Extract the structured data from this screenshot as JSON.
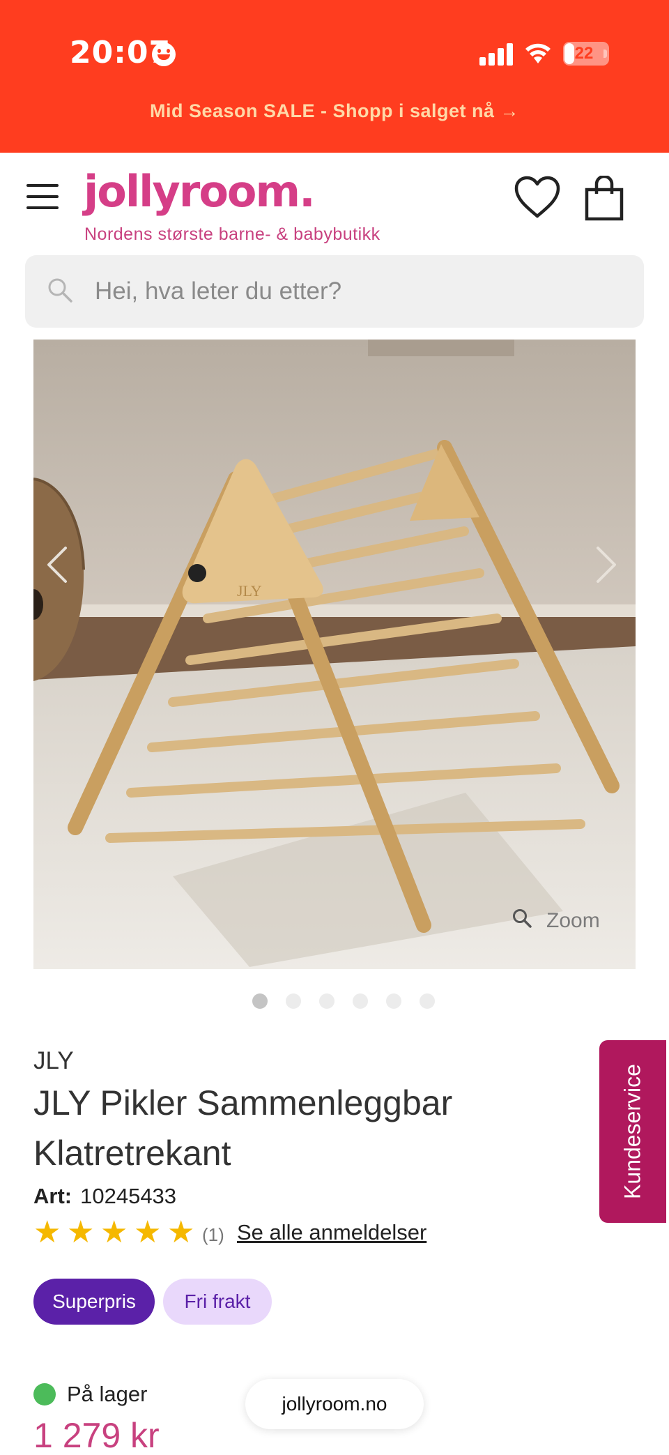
{
  "status_bar": {
    "time": "20:07",
    "battery": "22",
    "battery_level": 0.22,
    "background": "#ff3d1f"
  },
  "promo": {
    "text": "Mid Season SALE - Shopp i salget nå →"
  },
  "header": {
    "logo": "jollyroom.",
    "tagline": "Nordens største barne- & babybutikk",
    "brand_color": "#d53e87",
    "icons": [
      "menu-icon",
      "heart-icon",
      "bag-icon"
    ]
  },
  "search": {
    "placeholder": "Hei, hva leter du etter?"
  },
  "gallery": {
    "zoom_label": "Zoom",
    "image_count": 6,
    "active_index": 0
  },
  "product": {
    "brand": "JLY",
    "title": "JLY Pikler Sammenleggbar Klatretrekant",
    "art_label": "Art:",
    "art_number": "10245433",
    "rating": 5,
    "review_count": "(1)",
    "reviews_link": "Se alle anmeldelser",
    "badges": {
      "superpris": "Superpris",
      "fri_frakt": "Fri frakt"
    },
    "stock": "På lager",
    "stock_color": "#4cbb5a",
    "price": "1 279 kr"
  },
  "browser": {
    "url": "jollyroom.no"
  },
  "side_tab": {
    "label": "Kundeservice",
    "color": "#b0185d"
  }
}
